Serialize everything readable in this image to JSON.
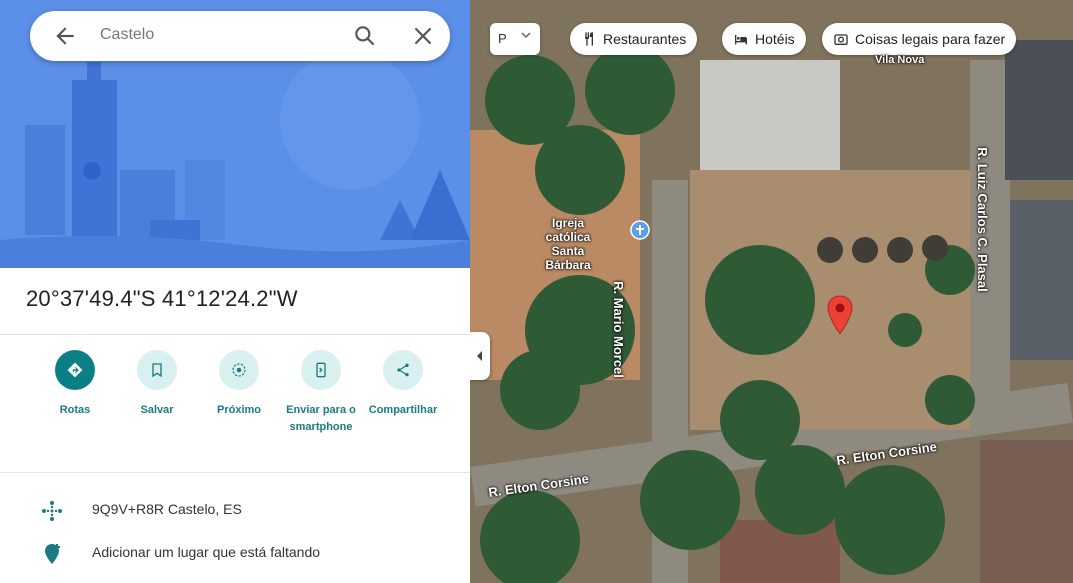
{
  "search": {
    "query": "Castelo"
  },
  "place": {
    "coordinates": "20°37'49.4\"S 41°12'24.2\"W"
  },
  "actions": [
    {
      "label": "Rotas",
      "icon": "directions-icon"
    },
    {
      "label": "Salvar",
      "icon": "bookmark-icon"
    },
    {
      "label": "Próximo",
      "icon": "nearby-icon"
    },
    {
      "label": "Enviar para o smartphone",
      "icon": "send-to-phone-icon"
    },
    {
      "label": "Compartilhar",
      "icon": "share-icon"
    }
  ],
  "info": {
    "plus_code": "9Q9V+R8R Castelo, ES",
    "add_missing_place": "Adicionar um lugar que está faltando"
  },
  "map": {
    "layers_label": "P",
    "chips": [
      {
        "label": "Restaurantes",
        "icon": "restaurant-icon"
      },
      {
        "label": "Hotéis",
        "icon": "hotel-icon"
      },
      {
        "label": "Coisas legais para fazer",
        "icon": "camera-icon"
      }
    ],
    "labels": {
      "church": "Igreja católica Santa Bárbara",
      "street_mario": "R. Mario Morcel",
      "street_luiz": "R. Luiz Carlos C. Plasal",
      "street_elton_right": "R. Elton Corsine",
      "street_elton_left": "R. Elton Corsine",
      "top_label": "Vila Nova"
    }
  },
  "colors": {
    "accent": "#0b7f86",
    "hero_blue": "#5b8fe8",
    "pin": "#ea4335"
  }
}
